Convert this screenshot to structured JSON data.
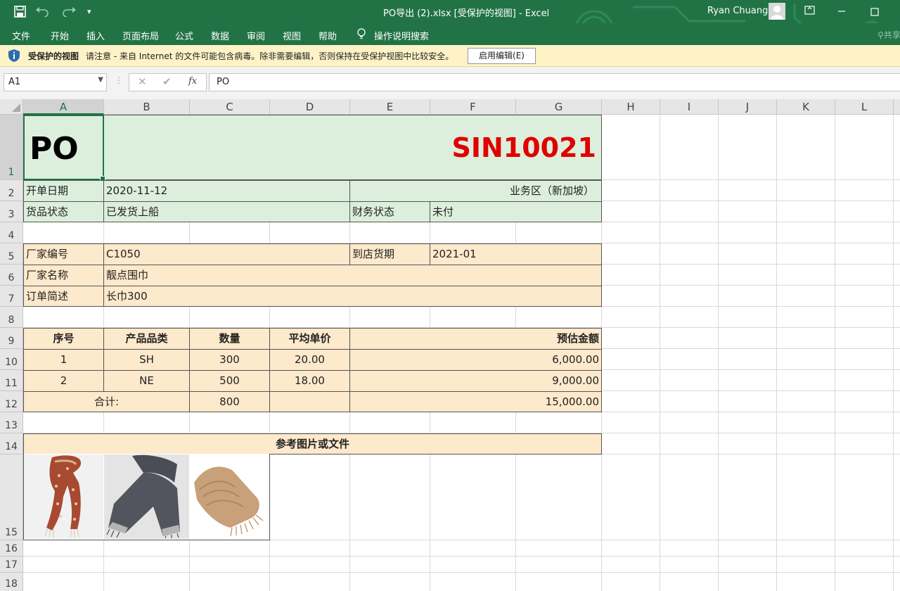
{
  "window": {
    "title": "PO导出 (2).xlsx  [受保护的视图]  -  Excel",
    "user": "Ryan Chuang"
  },
  "ribbon": {
    "tabs": [
      "文件",
      "开始",
      "插入",
      "页面布局",
      "公式",
      "数据",
      "审阅",
      "视图",
      "帮助"
    ],
    "tell_me": "操作说明搜索",
    "share": "共享"
  },
  "protected_view": {
    "title": "受保护的视图",
    "message": "请注意 - 来自 Internet 的文件可能包含病毒。除非需要编辑，否则保持在受保护视图中比较安全。",
    "button": "启用编辑(E)"
  },
  "formula_bar": {
    "name_box": "A1",
    "formula": "PO"
  },
  "columns": [
    "A",
    "B",
    "C",
    "D",
    "E",
    "F",
    "G",
    "H",
    "I",
    "J",
    "K",
    "L"
  ],
  "rows": [
    "1",
    "2",
    "3",
    "4",
    "5",
    "6",
    "7",
    "8",
    "9",
    "10",
    "11",
    "12",
    "13",
    "14",
    "15",
    "16",
    "17",
    "18"
  ],
  "sheet": {
    "title": "PO",
    "po_number": "SIN10021",
    "order_date_label": "开单日期",
    "order_date": "2020-11-12",
    "region": "业务区（新加坡）",
    "goods_status_label": "货品状态",
    "goods_status": "已发货上船",
    "finance_status_label": "财务状态",
    "finance_status": "未付",
    "vendor_code_label": "厂家编号",
    "vendor_code": "C1050",
    "arrival_label": "到店货期",
    "arrival": "2021-01",
    "vendor_name_label": "厂家名称",
    "vendor_name": "靓点围巾",
    "order_desc_label": "订单简述",
    "order_desc": "长巾300",
    "table": {
      "headers": [
        "序号",
        "产品品类",
        "数量",
        "平均单价",
        "预估金额"
      ],
      "rows": [
        [
          "1",
          "SH",
          "300",
          "20.00",
          "6,000.00"
        ],
        [
          "2",
          "NE",
          "500",
          "18.00",
          "9,000.00"
        ]
      ],
      "total_label": "合计:",
      "total_qty": "800",
      "total_amount": "15,000.00"
    },
    "reference_title": "参考图片或文件"
  },
  "colors": {
    "excel_green": "#217346",
    "header_green_fill": "#dcefdc",
    "orange_fill": "#fde9cb",
    "po_number_red": "#e00000"
  }
}
